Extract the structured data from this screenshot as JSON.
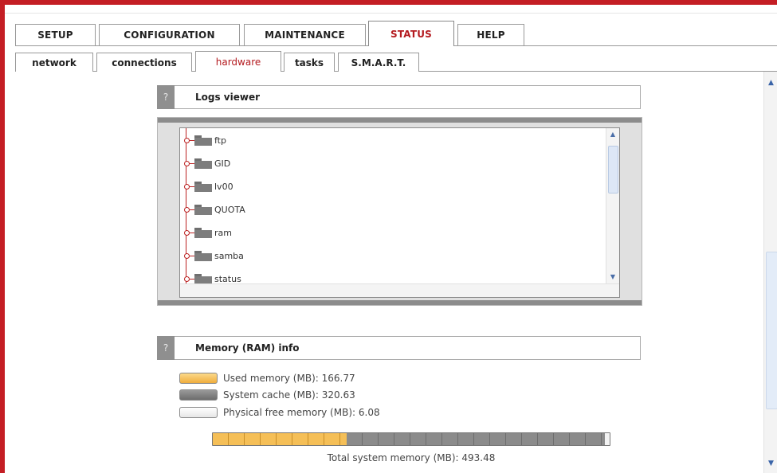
{
  "main_tabs": [
    {
      "label": "SETUP"
    },
    {
      "label": "CONFIGURATION"
    },
    {
      "label": "MAINTENANCE"
    },
    {
      "label": "STATUS",
      "active": true
    },
    {
      "label": "HELP"
    }
  ],
  "sub_tabs": [
    {
      "label": "network"
    },
    {
      "label": "connections"
    },
    {
      "label": "hardware",
      "active": true
    },
    {
      "label": "tasks"
    },
    {
      "label": "S.M.A.R.T."
    }
  ],
  "logs_viewer": {
    "help_icon": "?",
    "title": "Logs viewer",
    "items": [
      "ftp",
      "GID",
      "lv00",
      "QUOTA",
      "ram",
      "samba",
      "status"
    ]
  },
  "memory": {
    "help_icon": "?",
    "title": "Memory (RAM) info",
    "legend": [
      {
        "label": "Used memory (MB): 166.77",
        "color": "#f5bf57"
      },
      {
        "label": "System cache (MB): 320.63",
        "color": "#7a7a7a"
      },
      {
        "label": "Physical free memory (MB): 6.08",
        "color": "#f0f0f0"
      }
    ],
    "used_mb": 166.77,
    "cache_mb": 320.63,
    "free_mb": 6.08,
    "total_mb": 493.48,
    "total_label": "Total system memory (MB): 493.48"
  },
  "colors": {
    "accent": "#c41e24",
    "active_tab_text": "#b41a1f"
  }
}
